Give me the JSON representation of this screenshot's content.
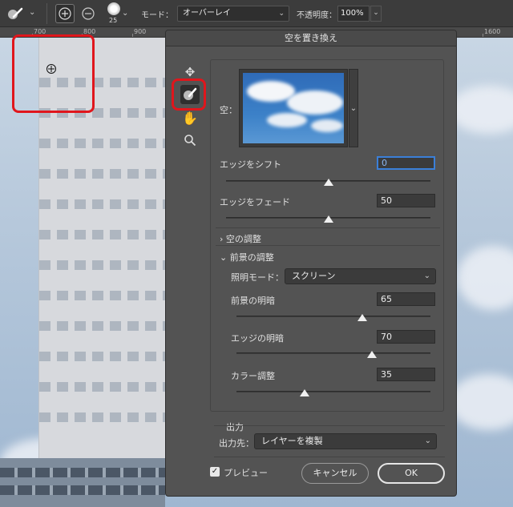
{
  "optionsbar": {
    "brush_size": "25",
    "mode_label": "モード：",
    "mode_value": "オーバーレイ",
    "opacity_label": "不透明度：",
    "opacity_value": "100%"
  },
  "ruler": {
    "ticks": [
      "700",
      "800",
      "900",
      "1600"
    ]
  },
  "dialog": {
    "title": "空を置き換え",
    "sky_label": "空：",
    "shift_edge": {
      "label": "エッジをシフト",
      "value": "0",
      "fraction": 0.5
    },
    "fade_edge": {
      "label": "エッジをフェード",
      "value": "50",
      "fraction": 0.5
    },
    "sky_adjust": {
      "label": "空の調整"
    },
    "foreground": {
      "label": "前景の調整",
      "lighting_label": "照明モード：",
      "lighting_value": "スクリーン",
      "lighting": {
        "label": "前景の明暗",
        "value": "65",
        "fraction": 0.65
      },
      "edge_light": {
        "label": "エッジの明暗",
        "value": "70",
        "fraction": 0.7
      },
      "color_adjust": {
        "label": "カラー調整",
        "value": "35",
        "fraction": 0.35
      }
    },
    "output": {
      "section": "出力",
      "label": "出力先：",
      "value": "レイヤーを複製"
    },
    "preview_label": "プレビュー",
    "cancel_label": "キャンセル",
    "ok_label": "OK"
  },
  "colors": {
    "highlight": "#e0161c",
    "focus": "#3b7fd8"
  }
}
